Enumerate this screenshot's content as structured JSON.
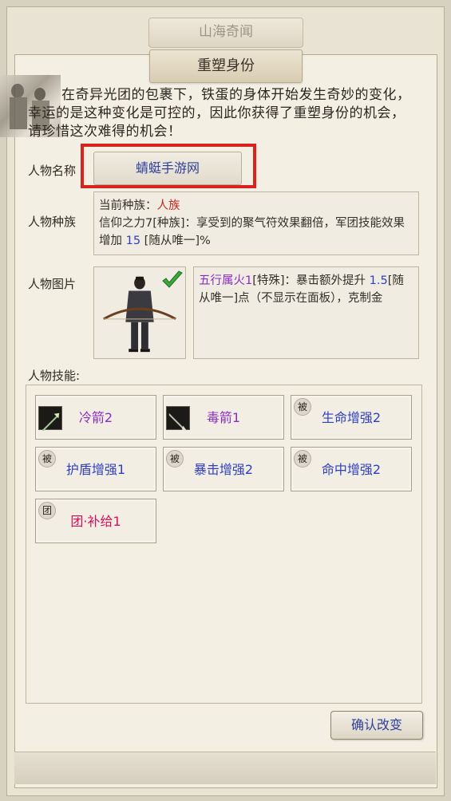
{
  "outer_title": "山海奇闻",
  "panel_title": "重塑身份",
  "intro_text": "在奇异光团的包裹下，铁蛋的身体开始发生奇妙的变化，幸运的是这种变化是可控的，因此你获得了重塑身份的机会，请珍惜这次难得的机会！",
  "name": {
    "label": "人物名称",
    "value": "蜻蜓手游网"
  },
  "race": {
    "label": "人物种族",
    "current_prefix": "当前种族：",
    "current_value": "人族",
    "desc_part1": "信仰之力7[种族]：享受到的聚气符效果翻倍，军团技能效果增加 ",
    "desc_number": "15",
    "desc_part2": " [随从唯一]%"
  },
  "portrait": {
    "label": "人物图片",
    "attr_name": "五行属火1",
    "attr_part1": "[特殊]：暴击额外提升 ",
    "attr_number": "1.5",
    "attr_part2": "[随从唯一]点（不显示在面板），克制金"
  },
  "skills": {
    "label": "人物技能:",
    "items": [
      {
        "name": "冷箭2",
        "color": "#8a2ec2",
        "marker": "icon"
      },
      {
        "name": "毒箭1",
        "color": "#8a2ec2",
        "marker": "icon"
      },
      {
        "name": "生命增强2",
        "color": "#2f3fc0",
        "marker": "被"
      },
      {
        "name": "护盾增强1",
        "color": "#2f3fc0",
        "marker": "被"
      },
      {
        "name": "暴击增强2",
        "color": "#2f3fc0",
        "marker": "被"
      },
      {
        "name": "命中增强2",
        "color": "#2f3fc0",
        "marker": "被"
      },
      {
        "name": "团·补给1",
        "color": "#d4105a",
        "marker": "团"
      }
    ]
  },
  "confirm_label": "确认改变"
}
